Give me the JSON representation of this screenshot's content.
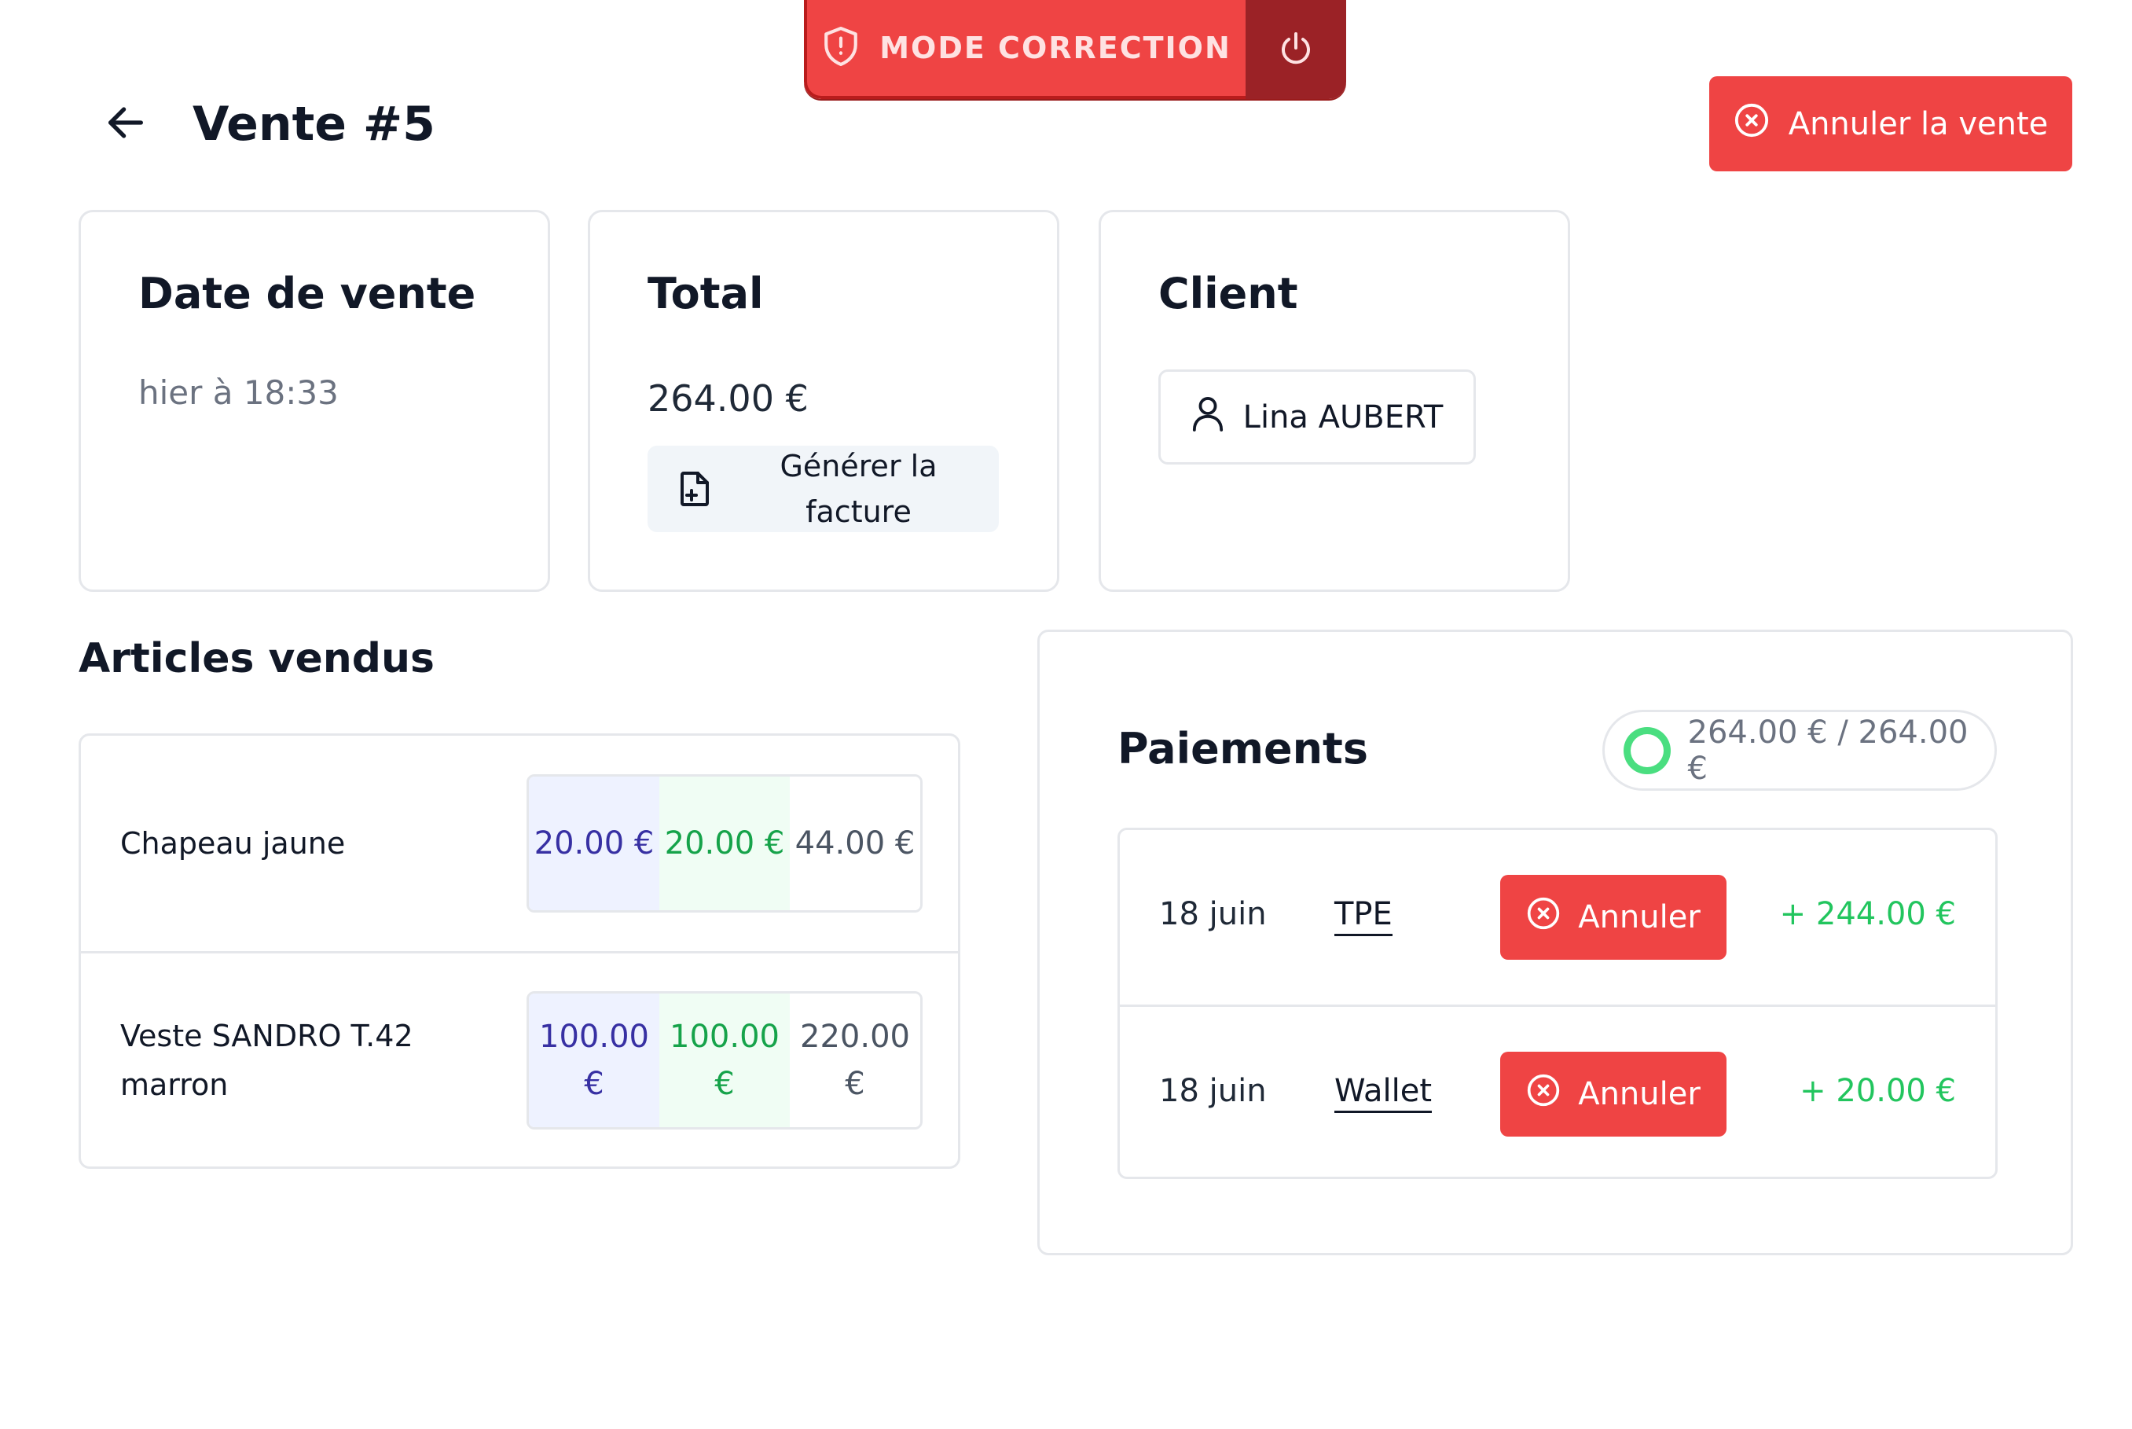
{
  "banner": {
    "label": "MODE CORRECTION"
  },
  "header": {
    "title": "Vente #5",
    "cancel_sale_label": "Annuler la vente"
  },
  "cards": {
    "date": {
      "title": "Date de vente",
      "value": "hier à 18:33"
    },
    "total": {
      "title": "Total",
      "value": "264.00 €",
      "invoice_label": "Générer la facture"
    },
    "client": {
      "title": "Client",
      "name": "Lina AUBERT"
    }
  },
  "articles": {
    "title": "Articles vendus",
    "items": [
      {
        "name": "Chapeau jaune",
        "price_1": "20.00 €",
        "price_2": "20.00 €",
        "price_3": "44.00 €"
      },
      {
        "name": "Veste SANDRO T.42 marron",
        "price_1": "100.00 €",
        "price_2": "100.00 €",
        "price_3": "220.00 €"
      }
    ]
  },
  "payments": {
    "title": "Paiements",
    "status": "264.00 € / 264.00 €",
    "items": [
      {
        "date": "18 juin",
        "method": "TPE",
        "cancel_label": "Annuler",
        "amount": "+ 244.00 €"
      },
      {
        "date": "18 juin",
        "method": "Wallet",
        "cancel_label": "Annuler",
        "amount": "+ 20.00 €"
      }
    ]
  },
  "colors": {
    "accent_red": "#ef4444",
    "dark_red": "#9b2226",
    "success_green": "#22c55e",
    "price_blue": "#3730a3"
  },
  "icons": {
    "banner": "shield-alert-icon",
    "power": "power-icon",
    "back": "arrow-left-icon",
    "cancel": "x-circle-icon",
    "invoice": "file-plus-icon",
    "client": "user-icon"
  }
}
